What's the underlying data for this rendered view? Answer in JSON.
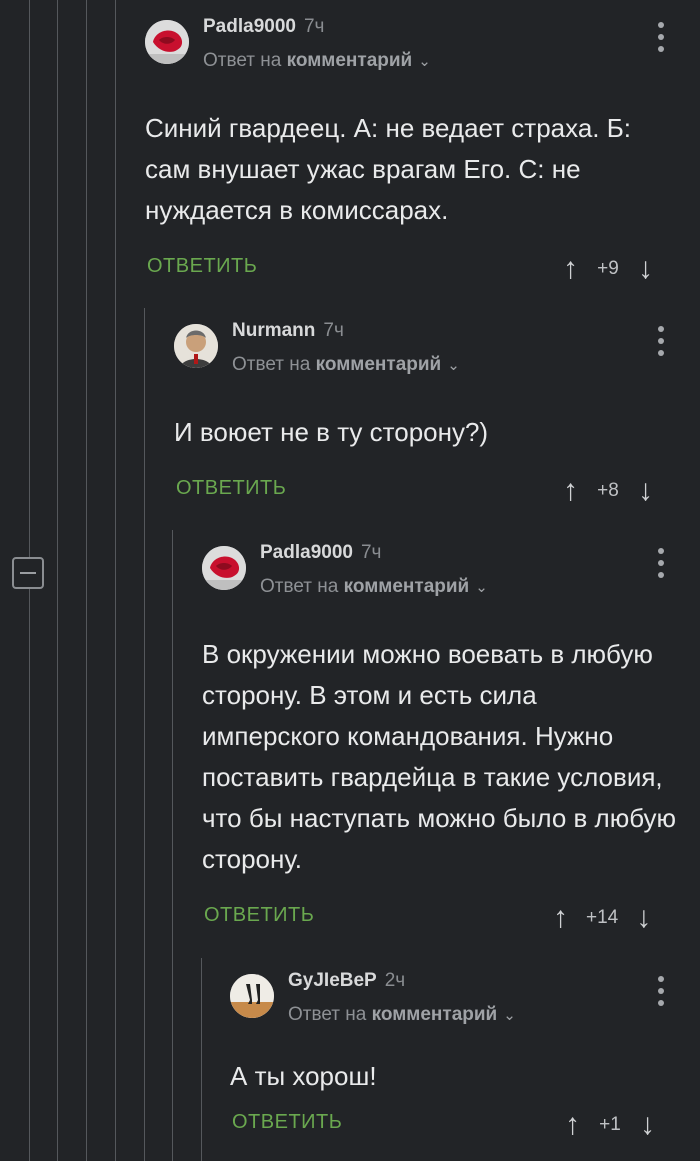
{
  "comments": [
    {
      "author": "Padla9000",
      "time": "7ч",
      "reply_prefix": "Ответ на",
      "reply_target": "комментарий",
      "text": "Синий гвардеец. А: не ведает страха. Б: сам внушает ужас врагам Его. С: не нуждается в комиссарах.",
      "reply_label": "ОТВЕТИТЬ",
      "rating": "+9"
    },
    {
      "author": "Nurmann",
      "time": "7ч",
      "reply_prefix": "Ответ на",
      "reply_target": "комментарий",
      "text": "И воюет не в ту сторону?)",
      "reply_label": "ОТВЕТИТЬ",
      "rating": "+8"
    },
    {
      "author": "Padla9000",
      "time": "7ч",
      "reply_prefix": "Ответ на",
      "reply_target": "комментарий",
      "text": "В окружении можно воевать в любую сторону. В этом и есть сила имперского командования. Нужно поставить гвардейца в такие условия, что бы наступать можно было в любую сторону.",
      "reply_label": "ОТВЕТИТЬ",
      "rating": "+14"
    },
    {
      "author": "GyJIeBeP",
      "time": "2ч",
      "reply_prefix": "Ответ на",
      "reply_target": "комментарий",
      "text": "А ты хорош!",
      "reply_label": "ОТВЕТИТЬ",
      "rating": "+1"
    }
  ],
  "icons": {
    "upvote": "arrow-up-icon",
    "downvote": "arrow-down-icon",
    "more": "more-vertical-icon",
    "collapse": "minus-icon",
    "dropdown": "chevron-down-icon"
  },
  "colors": {
    "background": "#222427",
    "reply_action": "#6aa84f",
    "thread_line": "#55585c"
  }
}
